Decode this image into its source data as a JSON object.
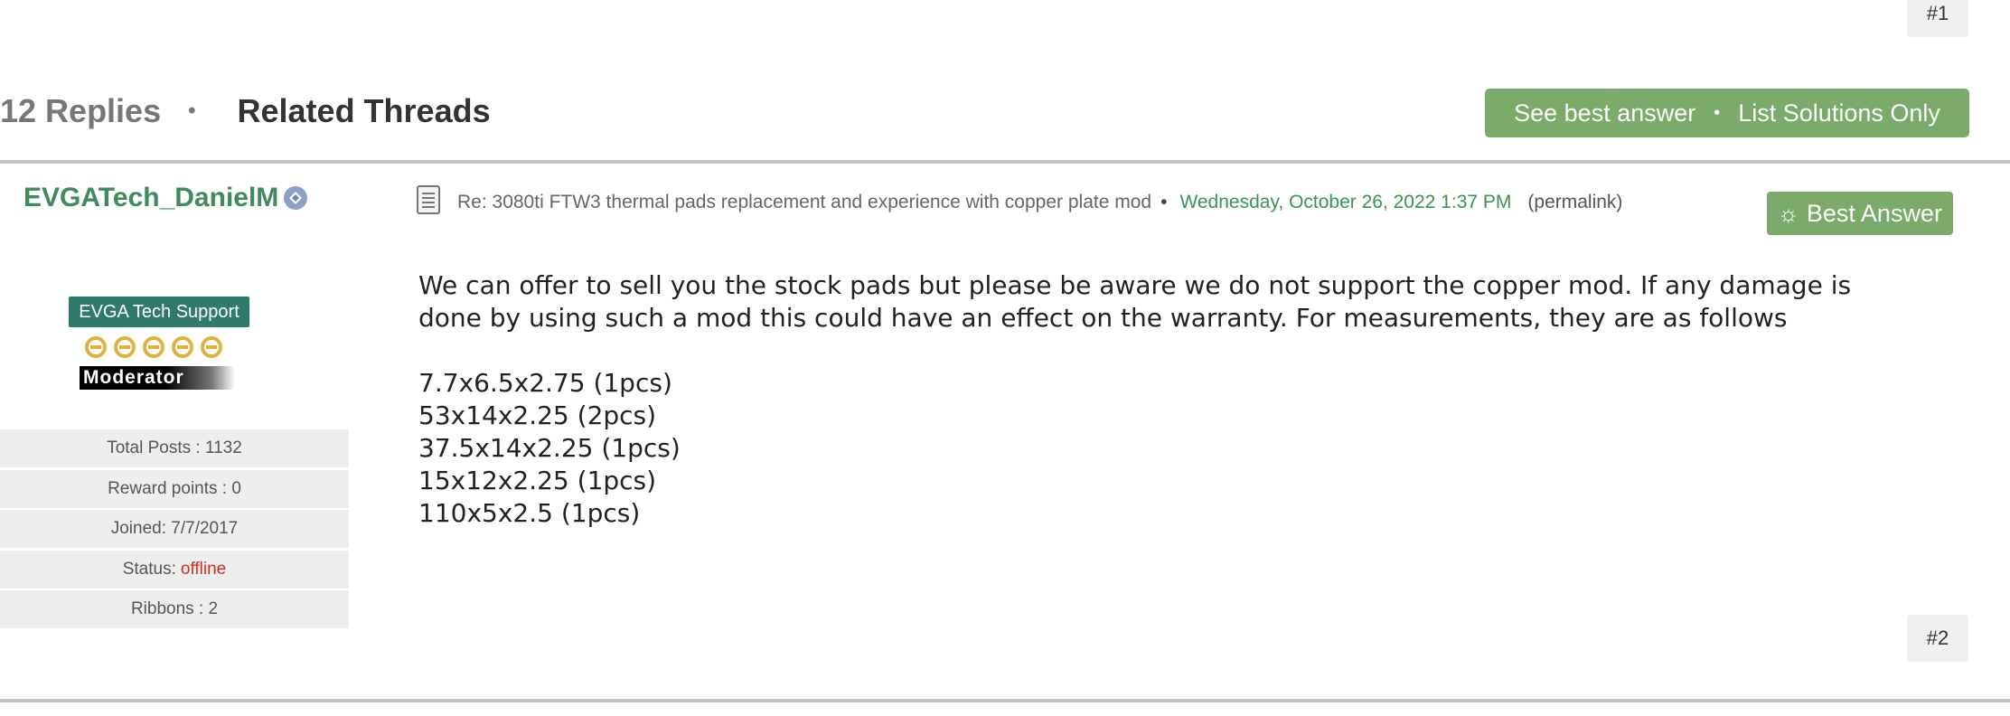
{
  "post1": {
    "number": "#1"
  },
  "thread_bar": {
    "replies": "12 Replies",
    "separator": "•",
    "related": "Related Threads",
    "see_best_answer": "See best answer",
    "list_solutions": "List Solutions Only"
  },
  "post2": {
    "author": "EVGATech_DanielM",
    "rank": "EVGA Tech Support",
    "moderator_label": "Moderator",
    "stats": {
      "total_posts": "Total Posts : 1132",
      "reward_points": "Reward points : 0",
      "joined": "Joined: 7/7/2017",
      "status_label": "Status:",
      "status_value": "offline",
      "ribbons": "Ribbons : 2"
    },
    "subject": "Re: 3080ti FTW3 thermal pads replacement and experience with copper plate mod",
    "date": "Wednesday, October 26, 2022 1:37 PM",
    "permalink": "(permalink)",
    "best_answer_label": "Best Answer",
    "body": {
      "paragraph": "We can offer to sell you the stock pads but please be aware we do not support the copper mod. If any damage is done by using such a mod this could have an effect on the warranty. For measurements, they are as follows",
      "lines": [
        "7.7x6.5x2.75 (1pcs)",
        "53x14x2.25 (2pcs)",
        "37.5x14x2.25 (1pcs)",
        "15x12x2.25 (1pcs)",
        "110x5x2.5 (1pcs)"
      ]
    },
    "number": "#2"
  },
  "colors": {
    "accent_green": "#7bab6b",
    "author_green": "#3f8b5c",
    "rank_teal": "#2f7a6c",
    "offline_red": "#d12e1e",
    "date_green": "#3a9450"
  }
}
